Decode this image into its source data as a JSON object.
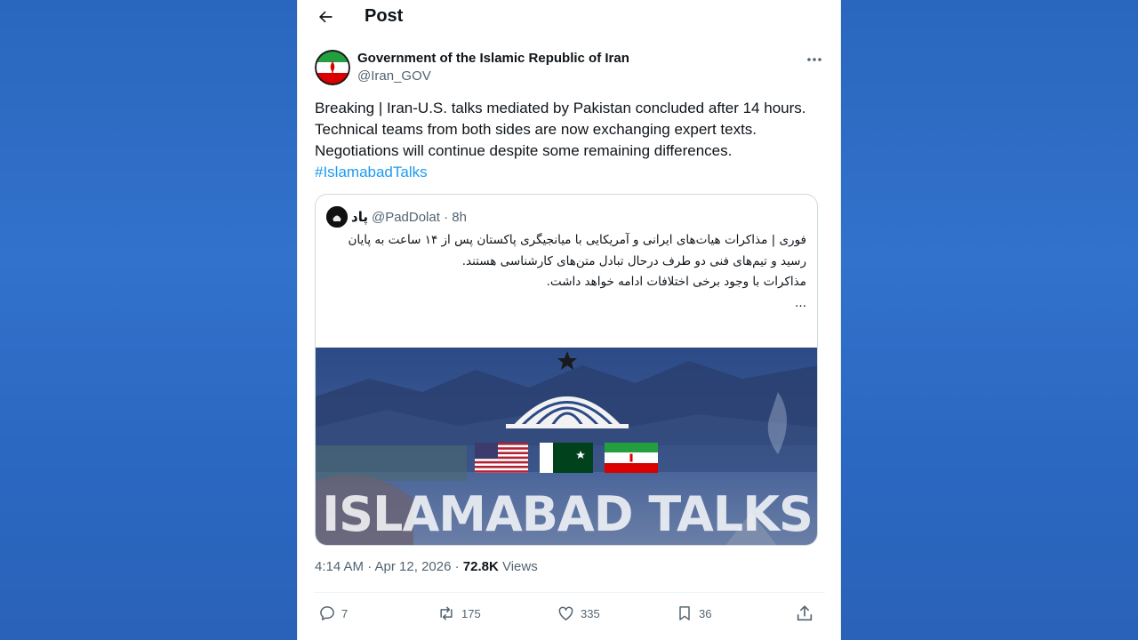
{
  "page": {
    "title": "Post"
  },
  "tweet": {
    "author_name": "Government of the Islamic Republic of Iran",
    "author_handle": "@Iran_GOV",
    "text_lines": [
      "Breaking | Iran-U.S. talks mediated by Pakistan concluded after 14 hours.",
      "Technical teams from both sides are now exchanging expert texts.",
      "Negotiations will continue despite some remaining differences."
    ],
    "hashtag": "#IslamabadTalks",
    "time": "4:14 AM · Apr 12, 2026 · ",
    "views_count": "72.8K",
    "views_label": " Views"
  },
  "quote": {
    "author_name": "پاد",
    "author_handle": "@PadDolat · 8h",
    "lines": [
      "فوری | مذاکرات هیات‌های ایرانی و آمریکایی با میانجیگری پاکستان پس از ۱۴ ساعت به پایان",
      "رسید و تیم‌های فنی دو طرف درحال تبادل متن‌های کارشناسی هستند.",
      "",
      "مذاکرات با وجود برخی اختلافات ادامه خواهد داشت.",
      "..."
    ],
    "image_caption": "ISLAMABAD TALKS"
  },
  "actions": {
    "replies": "7",
    "reposts": "175",
    "likes": "335",
    "bookmarks": "36"
  },
  "icons": {
    "back": "arrow-left-icon",
    "more": "more-icon",
    "reply": "reply-icon",
    "repost": "repost-icon",
    "like": "heart-icon",
    "bookmark": "bookmark-icon",
    "share": "share-icon"
  },
  "colors": {
    "link": "#1d9bf0",
    "background": "#2c6bc4",
    "secondary_text": "#536471"
  }
}
